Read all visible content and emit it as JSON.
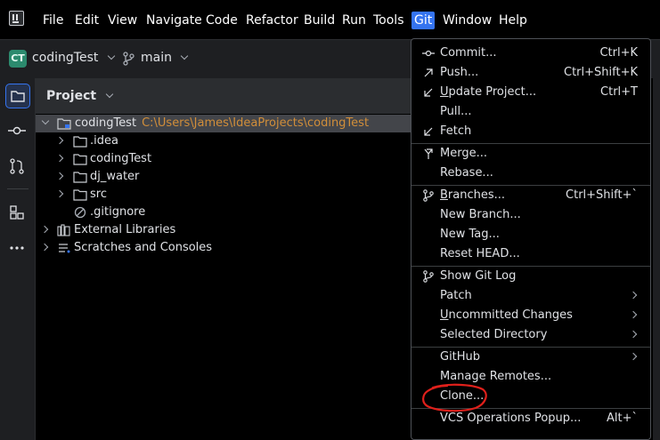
{
  "menubar": {
    "items": [
      "File",
      "Edit",
      "View",
      "Navigate",
      "Code",
      "Refactor",
      "Build",
      "Run",
      "Tools",
      "Git",
      "Window",
      "Help"
    ],
    "active": "Git"
  },
  "toolbar": {
    "project_badge": "CT",
    "project_name": "codingTest",
    "branch": "main"
  },
  "panel": {
    "title": "Project"
  },
  "tree": {
    "root_name": "codingTest",
    "root_path": "C:\\Users\\James\\IdeaProjects\\codingTest",
    "children": [
      ".idea",
      "codingTest",
      "dj_water",
      "src",
      ".gitignore"
    ],
    "external": "External Libraries",
    "scratches": "Scratches and Consoles"
  },
  "git_menu": {
    "items": [
      {
        "label": "Commit...",
        "shortcut": "Ctrl+K",
        "icon": "commit-icon"
      },
      {
        "label": "Push...",
        "shortcut": "Ctrl+Shift+K",
        "icon": "push-arrow-icon"
      },
      {
        "label": "Update Project...",
        "shortcut": "Ctrl+T",
        "icon": "update-arrow-icon"
      },
      {
        "label": "Pull...",
        "shortcut": "",
        "icon": ""
      },
      {
        "label": "Fetch",
        "shortcut": "",
        "icon": "fetch-arrow-icon"
      },
      {
        "label": "Merge...",
        "shortcut": "",
        "icon": "merge-icon"
      },
      {
        "label": "Rebase...",
        "shortcut": "",
        "icon": ""
      },
      {
        "label": "Branches...",
        "shortcut": "Ctrl+Shift+`",
        "icon": "branch-icon"
      },
      {
        "label": "New Branch...",
        "shortcut": "",
        "icon": ""
      },
      {
        "label": "New Tag...",
        "shortcut": "",
        "icon": ""
      },
      {
        "label": "Reset HEAD...",
        "shortcut": "",
        "icon": ""
      },
      {
        "label": "Show Git Log",
        "shortcut": "",
        "icon": "git-log-icon"
      },
      {
        "label": "Patch",
        "shortcut": "",
        "icon": "submenu-chevron-icon"
      },
      {
        "label": "Uncommitted Changes",
        "shortcut": "",
        "icon": "submenu-chevron-icon"
      },
      {
        "label": "Selected Directory",
        "shortcut": "",
        "icon": "submenu-chevron-icon"
      },
      {
        "label": "GitHub",
        "shortcut": "",
        "icon": "submenu-chevron-icon"
      },
      {
        "label": "Manage Remotes...",
        "shortcut": "",
        "icon": ""
      },
      {
        "label": "Clone...",
        "shortcut": "",
        "icon": ""
      },
      {
        "label": "VCS Operations Popup...",
        "shortcut": "Alt+`",
        "icon": ""
      }
    ]
  },
  "colors": {
    "accent": "#3574f0",
    "annotation": "#e0201b",
    "path": "#d18e3a"
  }
}
